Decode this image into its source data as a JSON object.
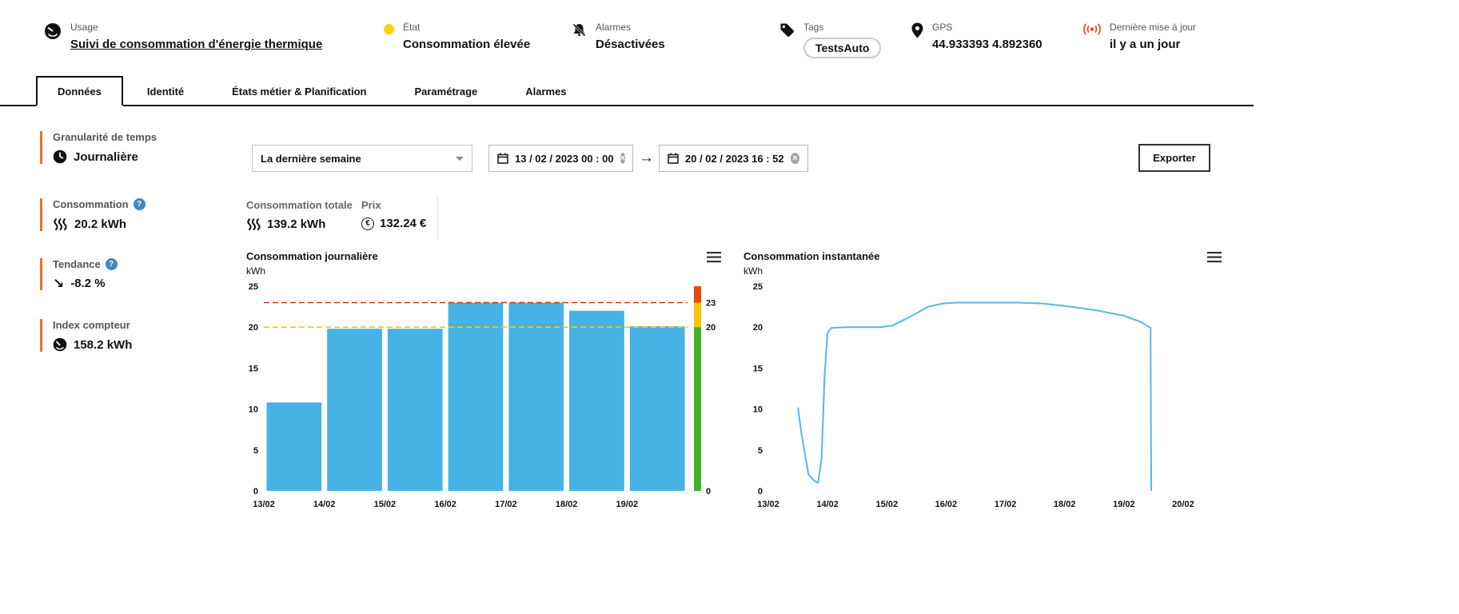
{
  "header": {
    "usage": {
      "label": "Usage",
      "value": "Suivi de consommation d'énergie thermique"
    },
    "status": {
      "label": "État",
      "value": "Consommation élevée",
      "dot_color": "#ffd10e"
    },
    "alarms": {
      "label": "Alarmes",
      "value": "Désactivées"
    },
    "tags": {
      "label": "Tags",
      "value": "TestsAuto"
    },
    "gps": {
      "label": "GPS",
      "value": "44.933393 4.892360"
    },
    "last_update": {
      "label": "Dernière mise à jour",
      "value": "il y a un jour"
    }
  },
  "tabs": [
    {
      "label": "Données",
      "active": true
    },
    {
      "label": "Identité",
      "active": false
    },
    {
      "label": "États métier & Planification",
      "active": false
    },
    {
      "label": "Paramétrage",
      "active": false
    },
    {
      "label": "Alarmes",
      "active": false
    }
  ],
  "sidebar": {
    "accent_color": "#ee7220",
    "items": [
      {
        "title": "Granularité de temps",
        "value": "Journalière",
        "icon": "clock-icon",
        "help": false
      },
      {
        "title": "Consommation",
        "value": "20.2 kWh",
        "icon": "heat-icon",
        "help": true
      },
      {
        "title": "Tendance",
        "value": "-8.2 %",
        "icon": "trend-down-icon",
        "help": true
      },
      {
        "title": "Index compteur",
        "value": "158.2 kWh",
        "icon": "meter-icon",
        "help": false
      }
    ]
  },
  "filters": {
    "period": {
      "value": "La dernière semaine"
    },
    "date_from": "13 / 02 / 2023  00 : 00",
    "date_to": "20 / 02 / 2023  16 : 52",
    "export_label": "Exporter"
  },
  "totals": {
    "consumption": {
      "label": "Consommation totale",
      "value": "139.2 kWh"
    },
    "price": {
      "label": "Prix",
      "value": "132.24 €"
    }
  },
  "chart_data": [
    {
      "type": "bar",
      "title": "Consommation journalière",
      "ylabel": "kWh",
      "ylim": [
        0,
        25
      ],
      "yticks": [
        0,
        5,
        10,
        15,
        20,
        25
      ],
      "categories": [
        "13/02",
        "14/02",
        "15/02",
        "16/02",
        "17/02",
        "18/02",
        "19/02"
      ],
      "values": [
        10.8,
        19.8,
        19.8,
        23,
        23,
        22,
        20.1
      ],
      "bar_color": "#47b2e4",
      "grid": false,
      "legend": "none",
      "thresholds": [
        {
          "value": 23,
          "color": "#d03500"
        },
        {
          "value": 20,
          "color": "#ffc400"
        }
      ],
      "gauge": {
        "labels": [
          23,
          20,
          0
        ],
        "colors": [
          "#e8490f",
          "#ffc400",
          "#3fb32a"
        ]
      }
    },
    {
      "type": "line",
      "title": "Consommation instantanée",
      "ylabel": "kWh",
      "ylim": [
        0,
        25
      ],
      "yticks": [
        0,
        5,
        10,
        15,
        20,
        25
      ],
      "x_ticks": [
        "13/02",
        "14/02",
        "15/02",
        "16/02",
        "17/02",
        "18/02",
        "19/02",
        "20/02"
      ],
      "line_color": "#56b6e8",
      "grid": false,
      "legend": "none",
      "points": [
        [
          0.5,
          10.2
        ],
        [
          0.56,
          7.0
        ],
        [
          0.68,
          2.0
        ],
        [
          0.78,
          1.2
        ],
        [
          0.84,
          1.0
        ],
        [
          0.9,
          4.0
        ],
        [
          0.95,
          14.0
        ],
        [
          1.0,
          19.3
        ],
        [
          1.06,
          19.9
        ],
        [
          1.3,
          20.0
        ],
        [
          1.9,
          20.0
        ],
        [
          2.1,
          20.2
        ],
        [
          2.4,
          21.3
        ],
        [
          2.7,
          22.5
        ],
        [
          2.95,
          22.9
        ],
        [
          3.2,
          23.0
        ],
        [
          4.2,
          23.0
        ],
        [
          4.6,
          22.9
        ],
        [
          5.0,
          22.6
        ],
        [
          5.5,
          22.1
        ],
        [
          6.0,
          21.4
        ],
        [
          6.3,
          20.6
        ],
        [
          6.45,
          19.9
        ],
        [
          6.46,
          0.0
        ]
      ]
    }
  ]
}
